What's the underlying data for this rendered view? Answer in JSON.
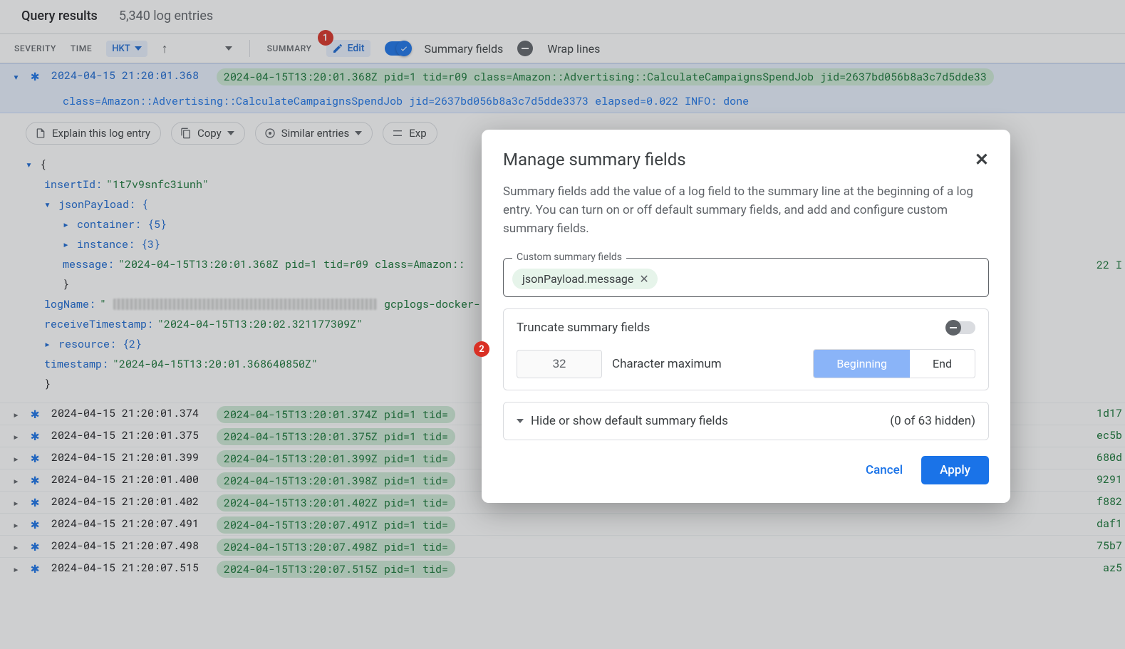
{
  "header": {
    "title": "Query results",
    "count": "5,340 log entries"
  },
  "toolbar": {
    "severity": "SEVERITY",
    "time": "TIME",
    "tz": "HKT",
    "summary": "SUMMARY",
    "edit": "Edit",
    "summary_fields": "Summary fields",
    "wrap": "Wrap lines"
  },
  "expanded": {
    "ts": "2024-04-15 21:20:01.368",
    "msg": "2024-04-15T13:20:01.368Z pid=1 tid=r09 class=Amazon::Advertising::CalculateCampaignsSpendJob jid=2637bd056b8a3c7d5dde33",
    "line2": "class=Amazon::Advertising::CalculateCampaignsSpendJob jid=2637bd056b8a3c7d5dde3373 elapsed=0.022 INFO: done"
  },
  "actions": {
    "explain": "Explain this log entry",
    "copy": "Copy",
    "similar": "Similar entries",
    "expand": "Exp"
  },
  "json": {
    "insertId_k": "insertId:",
    "insertId_v": "\"1t7v9snfc3iunh\"",
    "jsonPayload": "jsonPayload: {",
    "container": "container: {5}",
    "instance": "instance: {3}",
    "message_k": "message:",
    "message_v": "\"2024-04-15T13:20:01.368Z pid=1 tid=r09 class=Amazon::",
    "close": "}",
    "logName_k": "logName:",
    "logName_suffix": "gcplogs-docker-",
    "recvTs_k": "receiveTimestamp:",
    "recvTs_v": "\"2024-04-15T13:20:02.321177309Z\"",
    "resource": "resource: {2}",
    "ts_k": "timestamp:",
    "ts_v": "\"2024-04-15T13:20:01.368640850Z\""
  },
  "rows": [
    {
      "ts": "2024-04-15 21:20:01.374",
      "msg": "2024-04-15T13:20:01.374Z pid=1 tid=",
      "rhs": "1d17"
    },
    {
      "ts": "2024-04-15 21:20:01.375",
      "msg": "2024-04-15T13:20:01.375Z pid=1 tid=",
      "rhs": "ec5b"
    },
    {
      "ts": "2024-04-15 21:20:01.399",
      "msg": "2024-04-15T13:20:01.399Z pid=1 tid=",
      "rhs": "680d"
    },
    {
      "ts": "2024-04-15 21:20:01.400",
      "msg": "2024-04-15T13:20:01.398Z pid=1 tid=",
      "rhs": "9291"
    },
    {
      "ts": "2024-04-15 21:20:01.402",
      "msg": "2024-04-15T13:20:01.402Z pid=1 tid=",
      "rhs": "f882"
    },
    {
      "ts": "2024-04-15 21:20:07.491",
      "msg": "2024-04-15T13:20:07.491Z pid=1 tid=",
      "rhs": "daf1"
    },
    {
      "ts": "2024-04-15 21:20:07.498",
      "msg": "2024-04-15T13:20:07.498Z pid=1 tid=",
      "rhs": "75b7"
    },
    {
      "ts": "2024-04-15 21:20:07.515",
      "msg": "2024-04-15T13:20:07.515Z pid=1 tid=",
      "rhs": "az5"
    }
  ],
  "extra_msg": "22 I",
  "dialog": {
    "title": "Manage summary fields",
    "desc": "Summary fields add the value of a log field to the summary line at the beginning of a log entry. You can turn on or off default summary fields, and add and configure custom summary fields.",
    "legend": "Custom summary fields",
    "chip": "jsonPayload.message",
    "truncate": "Truncate summary fields",
    "char_max_val": "32",
    "char_max_lbl": "Character maximum",
    "begin": "Beginning",
    "end": "End",
    "hide_label": "Hide or show default summary fields",
    "hide_count": "(0 of 63 hidden)",
    "cancel": "Cancel",
    "apply": "Apply"
  },
  "badges": {
    "one": "1",
    "two": "2"
  }
}
